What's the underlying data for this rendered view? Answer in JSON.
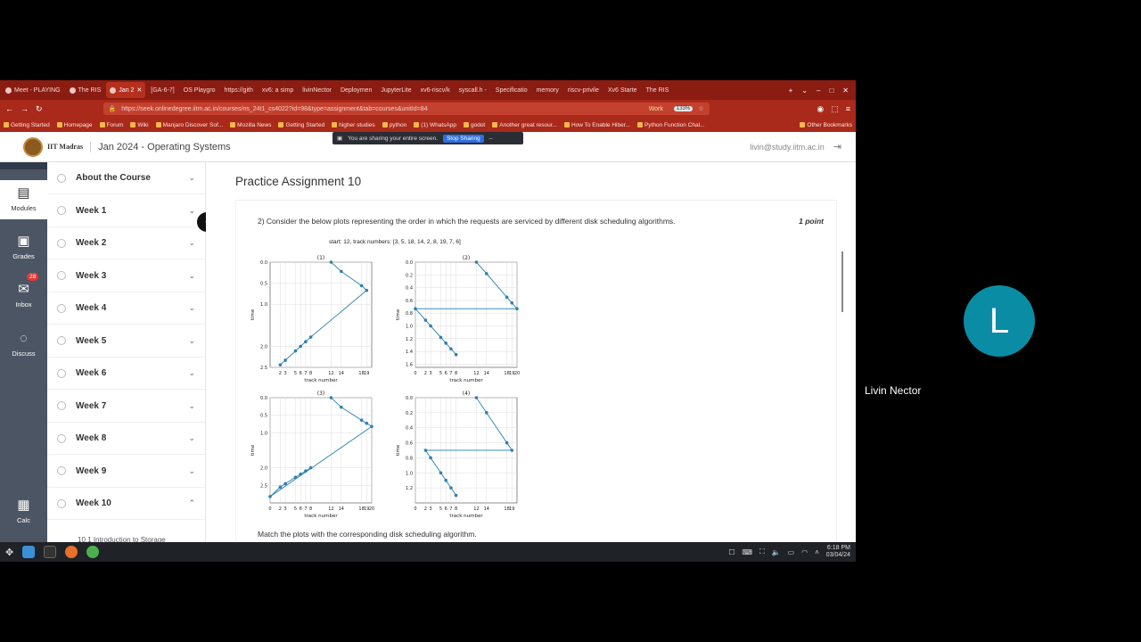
{
  "browser": {
    "tabs": [
      "Meet - PLAYING",
      "The RIS",
      "Jan 2",
      "[GA-6-7]",
      "OS Playgro",
      "https://gith",
      "xv6: a simp",
      "livinNector",
      "Deploymen",
      "JupyterLite",
      "xv6-riscv/k",
      "syscall.h - ",
      "Specificatio",
      "memory",
      "riscv-privile",
      "Xv6 Starte",
      "The RIS"
    ],
    "url": "https://seek.onlinedegree.iitm.ac.in/courses/ns_24t1_cs4022?id=98&type=assignment&tab=courses&unitId=84",
    "workspace_label": "Work",
    "zoom": "133%",
    "bookmarks": [
      "Getting Started",
      "Homepage",
      "Forum",
      "Wiki",
      "Manjaro Discover Sof...",
      "Mozilla News",
      "Getting Started",
      "higher studies",
      "python",
      "(1) WhatsApp",
      "godot",
      "Another great resour...",
      "How To Enable Hiber...",
      "Python Function Chal...",
      "Other Bookmarks"
    ]
  },
  "share_banner": {
    "text": "You are sharing your entire screen.",
    "button": "Stop Sharing",
    "minimize": "–"
  },
  "header": {
    "institute": "IIT Madras",
    "course": "Jan 2024 - Operating Systems",
    "email": "livin@study.iitm.ac.in"
  },
  "rail": [
    {
      "label": "Modules",
      "icon": "modules-icon",
      "glyph": "▤"
    },
    {
      "label": "Grades",
      "icon": "grades-icon",
      "glyph": "▣"
    },
    {
      "label": "Inbox",
      "icon": "inbox-icon",
      "glyph": "✉",
      "badge": "28"
    },
    {
      "label": "Discuss",
      "icon": "discuss-icon",
      "glyph": "◌"
    },
    {
      "label": "Calc",
      "icon": "calc-icon",
      "glyph": "▦"
    }
  ],
  "sidebar": {
    "items": [
      "About the Course",
      "Week 1",
      "Week 2",
      "Week 3",
      "Week 4",
      "Week 5",
      "Week 6",
      "Week 7",
      "Week 8",
      "Week 9",
      "Week 10"
    ],
    "subitem": "10.1 Introduction to Storage"
  },
  "main": {
    "title": "Practice Assignment 10",
    "question": "2)  Consider the below plots representing the order in which the requests are serviced by different disk scheduling algorithms.",
    "points": "1 point",
    "match_text": "Match the plots with the corresponding disk scheduling algorithm."
  },
  "chart_data": [
    {
      "type": "line",
      "title": "(1)",
      "suptitle": "start: 12, track numbers: [3, 5, 18, 14, 2, 8, 19, 7, 6]",
      "xlabel": "track number",
      "ylabel": "time",
      "y_inverted": true,
      "xticks": [
        "2",
        "3",
        "5",
        "6",
        "7",
        "8",
        "12",
        "14",
        "18",
        "19"
      ],
      "yticks": [
        "0.0",
        "0.5",
        "1.0",
        "2.0",
        "2.5"
      ],
      "ylim": [
        0,
        2.5
      ],
      "x": [
        12,
        14,
        18,
        19,
        8,
        7,
        6,
        5,
        3,
        2
      ],
      "y": [
        0.0,
        0.22,
        0.56,
        0.67,
        1.78,
        1.89,
        2.0,
        2.11,
        2.33,
        2.44
      ]
    },
    {
      "type": "line",
      "title": "(2)",
      "xlabel": "track number",
      "ylabel": "time",
      "y_inverted": true,
      "xticks": [
        "0",
        "2",
        "3",
        "5",
        "6",
        "7",
        "8",
        "12",
        "14",
        "18",
        "19",
        "20"
      ],
      "yticks": [
        "0.0",
        "0.2",
        "0.4",
        "0.6",
        "0.8",
        "1.0",
        "1.2",
        "1.4",
        "1.6"
      ],
      "ylim": [
        0,
        1.65
      ],
      "x": [
        12,
        14,
        18,
        19,
        20,
        0,
        2,
        3,
        5,
        6,
        7,
        8
      ],
      "y": [
        0.0,
        0.18,
        0.55,
        0.64,
        0.73,
        0.73,
        0.91,
        1.0,
        1.18,
        1.27,
        1.36,
        1.45
      ]
    },
    {
      "type": "line",
      "title": "(3)",
      "xlabel": "track number",
      "ylabel": "time",
      "y_inverted": true,
      "xticks": [
        "0",
        "2",
        "3",
        "5",
        "6",
        "7",
        "8",
        "12",
        "14",
        "18",
        "19",
        "20"
      ],
      "yticks": [
        "0.0",
        "0.5",
        "1.0",
        "2.0",
        "2.5"
      ],
      "ylim": [
        0,
        3.0
      ],
      "x": [
        12,
        14,
        18,
        19,
        20,
        0,
        2,
        3,
        5,
        6,
        7,
        8
      ],
      "y": [
        0.0,
        0.27,
        0.64,
        0.73,
        0.82,
        2.82,
        2.55,
        2.45,
        2.27,
        2.18,
        2.09,
        2.0
      ]
    },
    {
      "type": "line",
      "title": "(4)",
      "xlabel": "track number",
      "ylabel": "time",
      "y_inverted": true,
      "xticks": [
        "0",
        "2",
        "3",
        "5",
        "6",
        "7",
        "8",
        "12",
        "14",
        "18",
        "19"
      ],
      "yticks": [
        "0.0",
        "0.2",
        "0.4",
        "0.6",
        "0.8",
        "1.0",
        "1.2"
      ],
      "ylim": [
        0,
        1.4
      ],
      "x": [
        12,
        14,
        18,
        19,
        2,
        3,
        5,
        6,
        7,
        8
      ],
      "y": [
        0.0,
        0.2,
        0.6,
        0.7,
        0.7,
        0.8,
        1.0,
        1.1,
        1.2,
        1.3
      ]
    }
  ],
  "colors": {
    "browser": "#a9291a",
    "line": "#3a8cb7",
    "accent": "#0a8ca5"
  },
  "taskbar": {
    "time": "6:18 PM",
    "date": "03/04/24"
  },
  "participant": {
    "initial": "L",
    "name": "Livin Nector"
  }
}
